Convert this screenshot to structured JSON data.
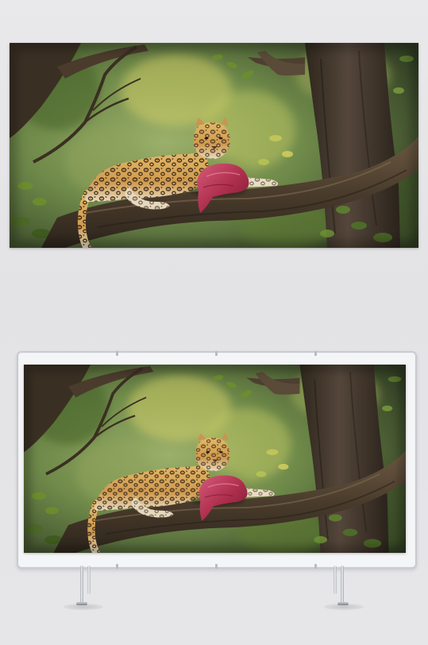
{
  "palette": {
    "background": "#e6e6e8",
    "forest": "#6f8a3a",
    "foliage_highlight": "#c9c85a",
    "bark": "#4a3a2a",
    "leopard_coat": "#d9a85a",
    "meat": "#b23a5a",
    "frame": "#c9cbd1"
  },
  "photo": {
    "subject": "leopard-resting-on-branch",
    "description_icon": "leopard-icon"
  },
  "banner_stand": {
    "frame_icon": "display-frame-icon",
    "legs_icon": "stand-legs-icon"
  }
}
